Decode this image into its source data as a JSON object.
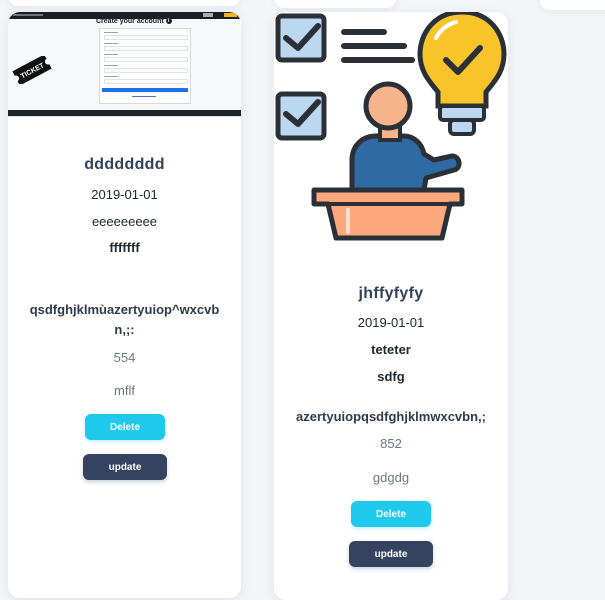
{
  "colors": {
    "page_bg": "#f3f5f8",
    "card_bg": "#ffffff",
    "title": "#34415a",
    "delete_button": "#1ec9ee",
    "update_button": "#34435f",
    "muted_text": "#6c7786",
    "bulb_yellow": "#f9c42a",
    "checkbox_blue": "#bcd8f1",
    "person_skin": "#f6b48c",
    "podium": "#fca87c",
    "shirt": "#2f6aa3"
  },
  "cards": [
    {
      "image": {
        "kind": "screenshot-thumbnail",
        "form_title": "Create your account",
        "ticket_text": "TICKET"
      },
      "title": "dddddddd",
      "date": "2019-01-01",
      "line1": "eeeeeeeee",
      "line2": "fffffff",
      "description": "qsdfghjklmùazertyuiop^wxcvbn,;:",
      "number": "554",
      "extra": "mflf",
      "delete_label": "Delete",
      "update_label": "update"
    },
    {
      "image": {
        "kind": "illustration",
        "icons": [
          "checkbox-checked-icon",
          "checkbox-checked-icon",
          "text-lines-icon",
          "lightbulb-check-icon",
          "presenter-podium-icon"
        ]
      },
      "title": "jhffyfyfy",
      "date": "2019-01-01",
      "line1": "teteter",
      "line2": "sdfg",
      "description": "azertyuiopqsdfghjklmwxcvbn,;",
      "number": "852",
      "extra": "gdgdg",
      "delete_label": "Delete",
      "update_label": "update"
    }
  ]
}
